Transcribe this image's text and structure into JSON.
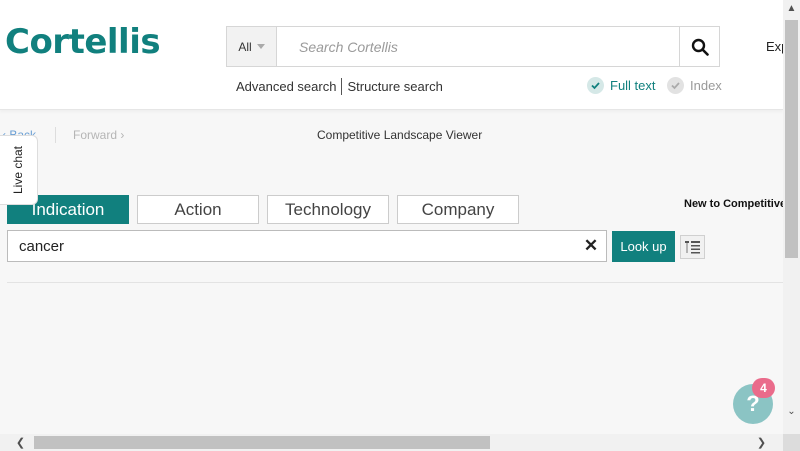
{
  "header": {
    "logo": "Cortellis",
    "scope": "All",
    "search_placeholder": "Search Cortellis",
    "exp_label": "Exp",
    "advanced_search": "Advanced search",
    "structure_search": "Structure search",
    "full_text": "Full text",
    "index": "Index"
  },
  "nav": {
    "back": "‹ Back",
    "forward": "Forward ›",
    "title": "Competitive Landscape Viewer"
  },
  "live_chat": "Live chat",
  "tabs": [
    {
      "label": "Indication",
      "active": true
    },
    {
      "label": "Action",
      "active": false
    },
    {
      "label": "Technology",
      "active": false
    },
    {
      "label": "Company",
      "active": false
    }
  ],
  "new_to": "New to Competitive",
  "lookup": {
    "value": "cancer",
    "clear": "✕",
    "button": "Look up"
  },
  "help": {
    "symbol": "?",
    "badge_count": "4"
  },
  "colors": {
    "brand": "#11807e",
    "badge": "#ea6b8b",
    "help": "#8bc4c4"
  }
}
